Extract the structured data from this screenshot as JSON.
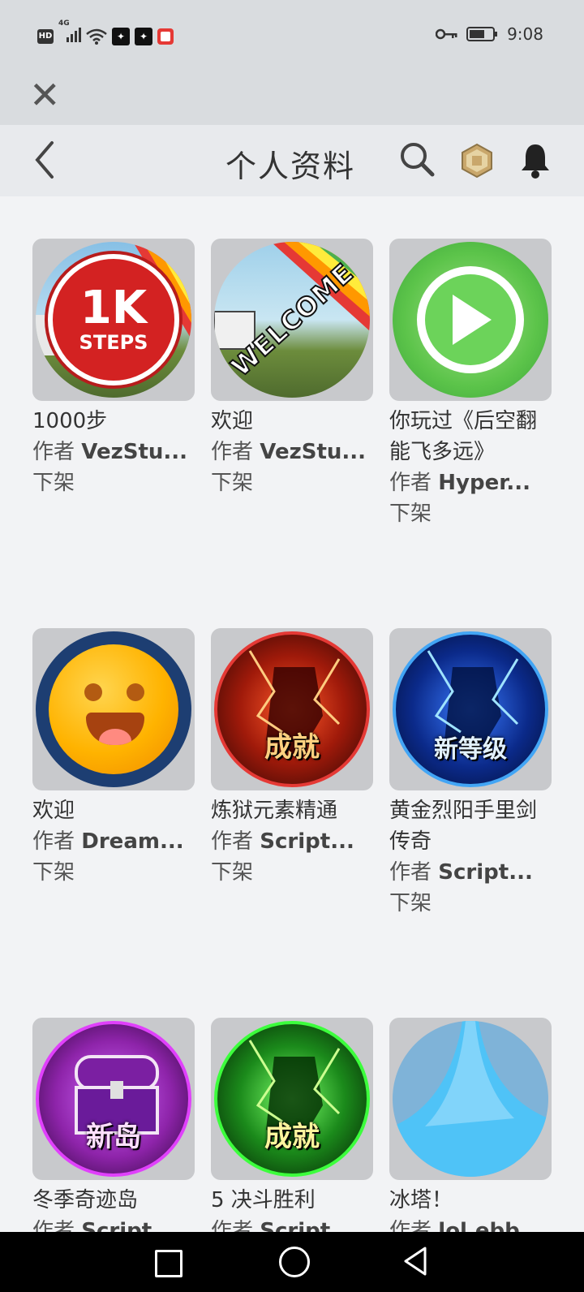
{
  "status_bar": {
    "time": "9:08",
    "net": "4G",
    "hd": "HD"
  },
  "nav": {
    "title": "个人资料"
  },
  "labels": {
    "author_prefix": "作者"
  },
  "items": [
    {
      "name": "1000步",
      "author": "VezStu...",
      "status": "下架",
      "badge_text": "1K",
      "badge_sub": "STEPS"
    },
    {
      "name": "欢迎",
      "author": "VezStu...",
      "status": "下架",
      "badge_text": "WELCOME"
    },
    {
      "name": "你玩过《后空翻能飞多远》",
      "author": "Hyper...",
      "status": "下架"
    },
    {
      "name": "欢迎",
      "author": "Dream...",
      "status": "下架"
    },
    {
      "name": "炼狱元素精通",
      "author": "Script...",
      "status": "下架",
      "badge_text": "成就"
    },
    {
      "name": "黄金烈阳手里剑传奇",
      "author": "Script...",
      "status": "下架",
      "badge_text": "新等级"
    },
    {
      "name": "冬季奇迹岛",
      "author": "Script...",
      "status": "",
      "badge_text": "新岛"
    },
    {
      "name": "5 决斗胜利",
      "author": "Script...",
      "status": "",
      "badge_text": "成就"
    },
    {
      "name": "冰塔！",
      "author": "lol.ebb...",
      "status": ""
    }
  ],
  "colors": {
    "accent_red": "#e53935",
    "background": "#f2f3f5"
  }
}
